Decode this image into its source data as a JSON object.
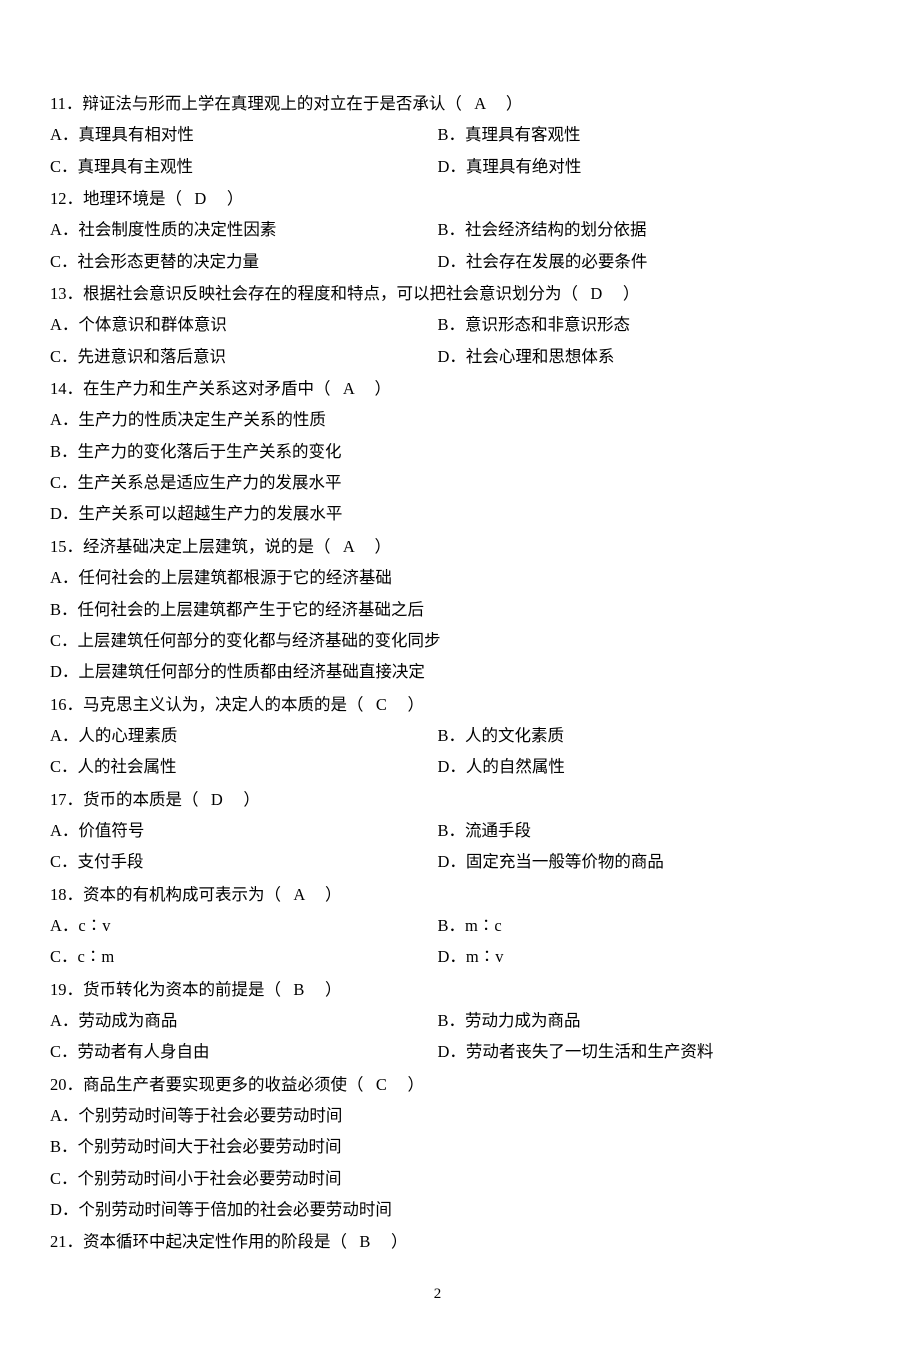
{
  "page_number": "2",
  "questions": [
    {
      "num": "11",
      "stem_pre": "辩证法与形而上学在真理观上的对立在于是否承认（",
      "answer": "A",
      "stem_post": "）",
      "layout": "two-col",
      "options": [
        {
          "label": "A．",
          "text": "真理具有相对性"
        },
        {
          "label": "B．",
          "text": "真理具有客观性"
        },
        {
          "label": "C．",
          "text": "真理具有主观性"
        },
        {
          "label": "D．",
          "text": "真理具有绝对性"
        }
      ]
    },
    {
      "num": "12",
      "stem_pre": "地理环境是（",
      "answer": "D",
      "stem_post": "）",
      "layout": "two-col",
      "options": [
        {
          "label": "A．",
          "text": "社会制度性质的决定性因素"
        },
        {
          "label": "B．",
          "text": "社会经济结构的划分依据"
        },
        {
          "label": "C．",
          "text": "社会形态更替的决定力量"
        },
        {
          "label": "D．",
          "text": "社会存在发展的必要条件"
        }
      ]
    },
    {
      "num": "13",
      "stem_pre": "根据社会意识反映社会存在的程度和特点，可以把社会意识划分为（",
      "answer": "D",
      "stem_post": "）",
      "layout": "two-col",
      "options": [
        {
          "label": "A．",
          "text": "个体意识和群体意识"
        },
        {
          "label": "B．",
          "text": "意识形态和非意识形态"
        },
        {
          "label": "C．",
          "text": "先进意识和落后意识"
        },
        {
          "label": "D．",
          "text": "社会心理和思想体系"
        }
      ]
    },
    {
      "num": "14",
      "stem_pre": "在生产力和生产关系这对矛盾中（",
      "answer": "A",
      "stem_post": "）",
      "layout": "single-col",
      "options": [
        {
          "label": "A．",
          "text": "生产力的性质决定生产关系的性质"
        },
        {
          "label": "B．",
          "text": "生产力的变化落后于生产关系的变化"
        },
        {
          "label": "C．",
          "text": "生产关系总是适应生产力的发展水平"
        },
        {
          "label": "D．",
          "text": "生产关系可以超越生产力的发展水平"
        }
      ]
    },
    {
      "num": "15",
      "stem_pre": "经济基础决定上层建筑，说的是（",
      "answer": "A",
      "stem_post": "）",
      "layout": "single-col",
      "options": [
        {
          "label": "A．",
          "text": "任何社会的上层建筑都根源于它的经济基础"
        },
        {
          "label": "B．",
          "text": "任何社会的上层建筑都产生于它的经济基础之后"
        },
        {
          "label": "C．",
          "text": "上层建筑任何部分的变化都与经济基础的变化同步"
        },
        {
          "label": "D．",
          "text": "上层建筑任何部分的性质都由经济基础直接决定"
        }
      ]
    },
    {
      "num": "16",
      "stem_pre": "马克思主义认为，决定人的本质的是（",
      "answer": "C",
      "stem_post": "）",
      "layout": "two-col",
      "options": [
        {
          "label": "A．",
          "text": "人的心理素质"
        },
        {
          "label": "B．",
          "text": "人的文化素质"
        },
        {
          "label": "C．",
          "text": "人的社会属性"
        },
        {
          "label": "D．",
          "text": "人的自然属性"
        }
      ]
    },
    {
      "num": "17",
      "stem_pre": "货币的本质是（",
      "answer": "D",
      "stem_post": "）",
      "layout": "two-col",
      "options": [
        {
          "label": "A．",
          "text": "价值符号"
        },
        {
          "label": "B．",
          "text": "流通手段"
        },
        {
          "label": "C．",
          "text": "支付手段"
        },
        {
          "label": "D．",
          "text": "固定充当一般等价物的商品"
        }
      ]
    },
    {
      "num": "18",
      "stem_pre": "资本的有机构成可表示为（",
      "answer": "A",
      "stem_post": "）",
      "layout": "two-col",
      "options": [
        {
          "label": "A．",
          "text": "c∶v"
        },
        {
          "label": "B．",
          "text": "m∶c"
        },
        {
          "label": "C．",
          "text": "c∶m"
        },
        {
          "label": "D．",
          "text": "m∶v"
        }
      ]
    },
    {
      "num": "19",
      "stem_pre": "货币转化为资本的前提是（",
      "answer": "B",
      "stem_post": "）",
      "layout": "two-col",
      "options": [
        {
          "label": "A．",
          "text": "劳动成为商品"
        },
        {
          "label": "B．",
          "text": "劳动力成为商品"
        },
        {
          "label": "C．",
          "text": "劳动者有人身自由"
        },
        {
          "label": "D．",
          "text": "劳动者丧失了一切生活和生产资料"
        }
      ]
    },
    {
      "num": "20",
      "stem_pre": "商品生产者要实现更多的收益必须使（",
      "answer": "C",
      "stem_post": "）",
      "layout": "single-col",
      "options": [
        {
          "label": "A．",
          "text": "个别劳动时间等于社会必要劳动时间"
        },
        {
          "label": "B．",
          "text": "个别劳动时间大于社会必要劳动时间"
        },
        {
          "label": "C．",
          "text": "个别劳动时间小于社会必要劳动时间"
        },
        {
          "label": "D．",
          "text": "个别劳动时间等于倍加的社会必要劳动时间"
        }
      ]
    },
    {
      "num": "21",
      "stem_pre": "资本循环中起决定性作用的阶段是（",
      "answer": "B",
      "stem_post": "）",
      "layout": "none",
      "options": []
    }
  ]
}
